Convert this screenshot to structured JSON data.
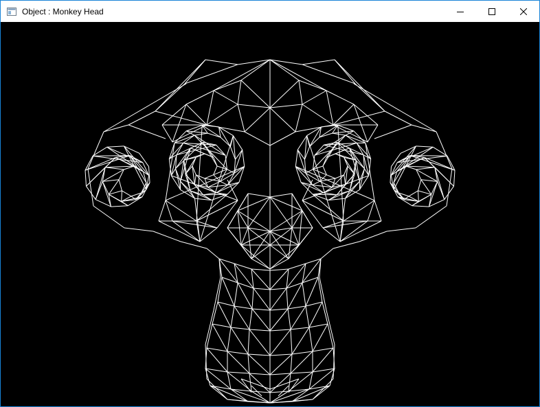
{
  "window": {
    "title": "Object : Monkey Head",
    "icon": "app-window-icon"
  },
  "controls": {
    "minimize": "minimize-icon",
    "maximize": "maximize-icon",
    "close": "close-icon"
  },
  "viewport": {
    "background": "#000000",
    "wire_color": "#ffffff",
    "object": "Monkey Head"
  }
}
